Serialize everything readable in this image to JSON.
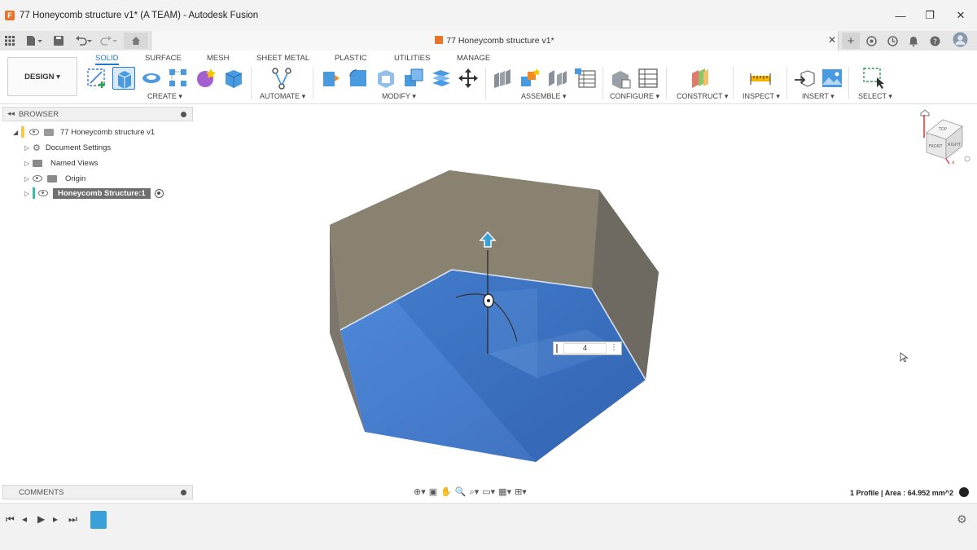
{
  "window": {
    "title": "77 Honeycomb structure v1* (A TEAM) - Autodesk Fusion",
    "minimize_label": "—",
    "maximize_label": "❐",
    "close_label": "✕"
  },
  "appbar": {
    "doc_tab_title": "77 Honeycomb structure v1*",
    "doc_tab_close": "✕",
    "new_tab": "+"
  },
  "ribbon": {
    "workspace_button": "DESIGN ▾",
    "tabs": [
      "SOLID",
      "SURFACE",
      "MESH",
      "SHEET METAL",
      "PLASTIC",
      "UTILITIES",
      "MANAGE"
    ],
    "active_tab": "SOLID",
    "groups": {
      "create": "CREATE ▾",
      "automate": "AUTOMATE ▾",
      "modify": "MODIFY ▾",
      "assemble": "ASSEMBLE ▾",
      "configure": "CONFIGURE ▾",
      "construct": "CONSTRUCT ▾",
      "inspect": "INSPECT ▾",
      "insert": "INSERT ▾",
      "select": "SELECT ▾"
    }
  },
  "browser": {
    "title": "BROWSER",
    "root": "77 Honeycomb structure v1",
    "items": [
      {
        "label": "Document Settings",
        "icon": "gear-icon"
      },
      {
        "label": "Named Views",
        "icon": "folder-icon"
      },
      {
        "label": "Origin",
        "icon": "folder-icon"
      },
      {
        "label": "Honeycomb Structure:1",
        "icon": "component-icon"
      }
    ]
  },
  "comments": {
    "title": "COMMENTS"
  },
  "viewport": {
    "dimension_value": "4",
    "viewcube_faces": [
      "TOP",
      "FRONT",
      "RIGHT"
    ]
  },
  "status": {
    "profile_info": "1 Profile | Area : 64.952 mm^2"
  },
  "colors": {
    "accent": "#1f78d1",
    "body_top": "#8a8270",
    "profile_blue": "#2f6fc8"
  }
}
